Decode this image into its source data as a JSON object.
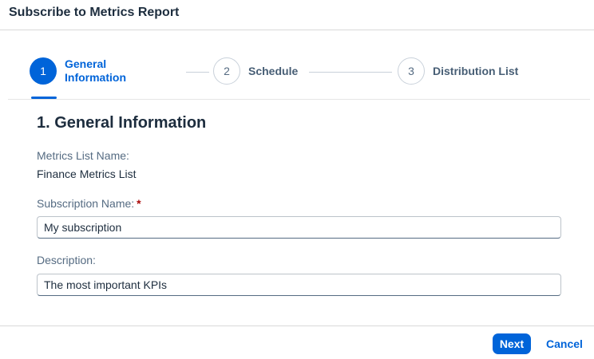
{
  "dialog": {
    "title": "Subscribe to Metrics Report"
  },
  "wizard": {
    "steps": [
      {
        "number": "1",
        "label": "General Information",
        "state": "active"
      },
      {
        "number": "2",
        "label": "Schedule",
        "state": "inactive"
      },
      {
        "number": "3",
        "label": "Distribution List",
        "state": "inactive"
      }
    ]
  },
  "section": {
    "title": "1. General Information"
  },
  "form": {
    "metrics_list": {
      "label": "Metrics List Name:",
      "value": "Finance Metrics List"
    },
    "subscription_name": {
      "label": "Subscription Name:",
      "required_mark": "*",
      "value": "My subscription"
    },
    "description": {
      "label": "Description:",
      "value": "The most important KPIs"
    }
  },
  "footer": {
    "next_label": "Next",
    "cancel_label": "Cancel"
  },
  "colors": {
    "accent": "#0064d9",
    "required": "#aa0808"
  }
}
